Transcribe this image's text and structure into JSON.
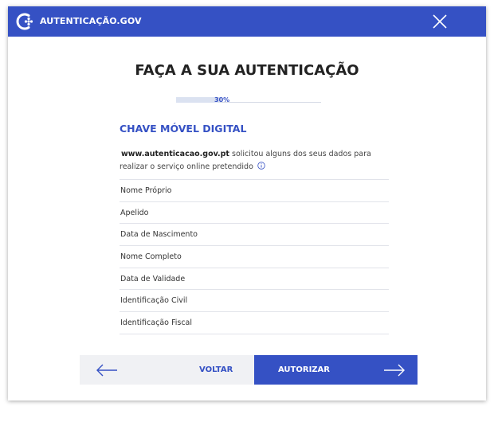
{
  "header": {
    "brand": "AUTENTICAÇÃO.GOV"
  },
  "title": "FAÇA A SUA AUTENTICAÇÃO",
  "progress": {
    "value": 0.3,
    "label": "30%"
  },
  "section_title": "CHAVE MÓVEL DIGITAL",
  "description": {
    "site": "www.autenticacao.gov.pt",
    "text": " solicitou alguns dos seus dados para realizar o serviço online pretendido"
  },
  "fields": [
    {
      "label": "Nome Próprio"
    },
    {
      "label": "Apelido"
    },
    {
      "label": "Data de Nascimento"
    },
    {
      "label": "Nome Completo"
    },
    {
      "label": "Data de Validade"
    },
    {
      "label": "Identificação Civil"
    },
    {
      "label": "Identificação Fiscal"
    }
  ],
  "buttons": {
    "back": "VOLTAR",
    "authorize": "AUTORIZAR"
  },
  "colors": {
    "primary": "#3551c4",
    "back_bg": "#f0f1f4",
    "progress_fill": "#dbe2f1"
  },
  "icons": {
    "logo": "autenticacao-logo-icon",
    "close": "close-icon",
    "info": "info-icon",
    "back": "arrow-left-icon",
    "forward": "arrow-right-icon"
  }
}
